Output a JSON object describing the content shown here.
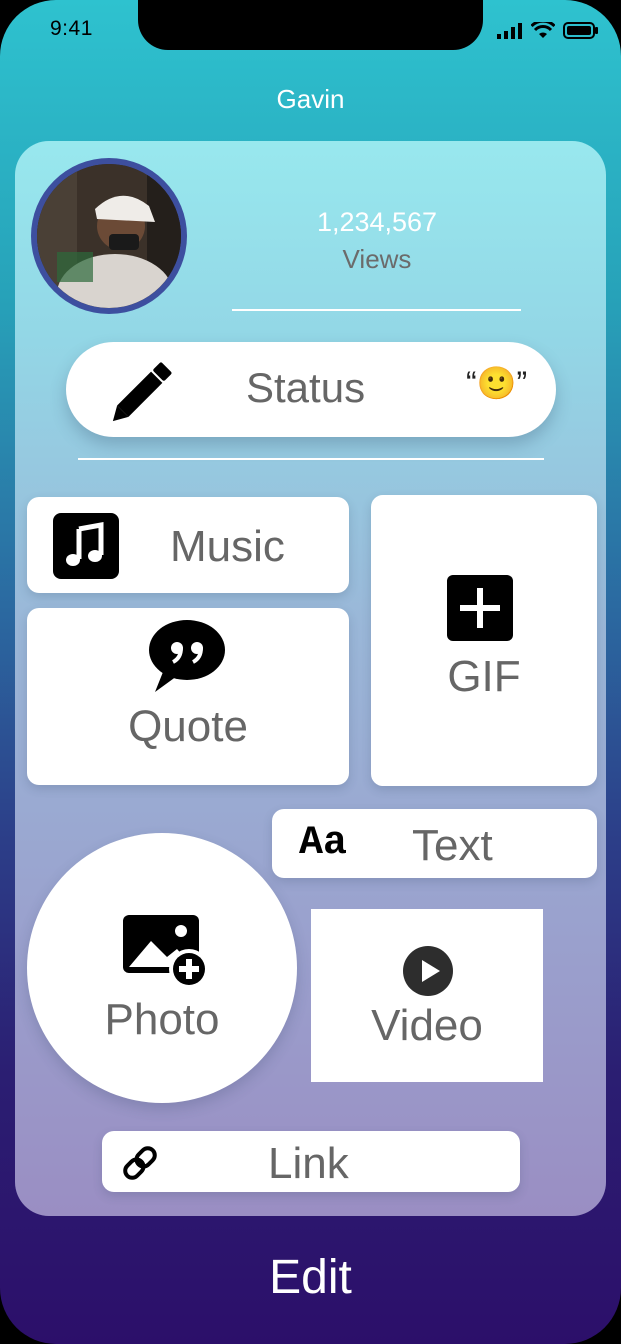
{
  "statusbar": {
    "time": "9:41"
  },
  "header": {
    "title": "Gavin"
  },
  "profile": {
    "views_count": "1,234,567",
    "views_label": "Views"
  },
  "status": {
    "label": "Status",
    "emoji": "“🙂”"
  },
  "tiles": {
    "music": "Music",
    "gif": "GIF",
    "quote": "Quote",
    "text": "Text",
    "text_icon": "Aa",
    "photo": "Photo",
    "video": "Video",
    "link": "Link"
  },
  "footer": {
    "edit_label": "Edit"
  }
}
